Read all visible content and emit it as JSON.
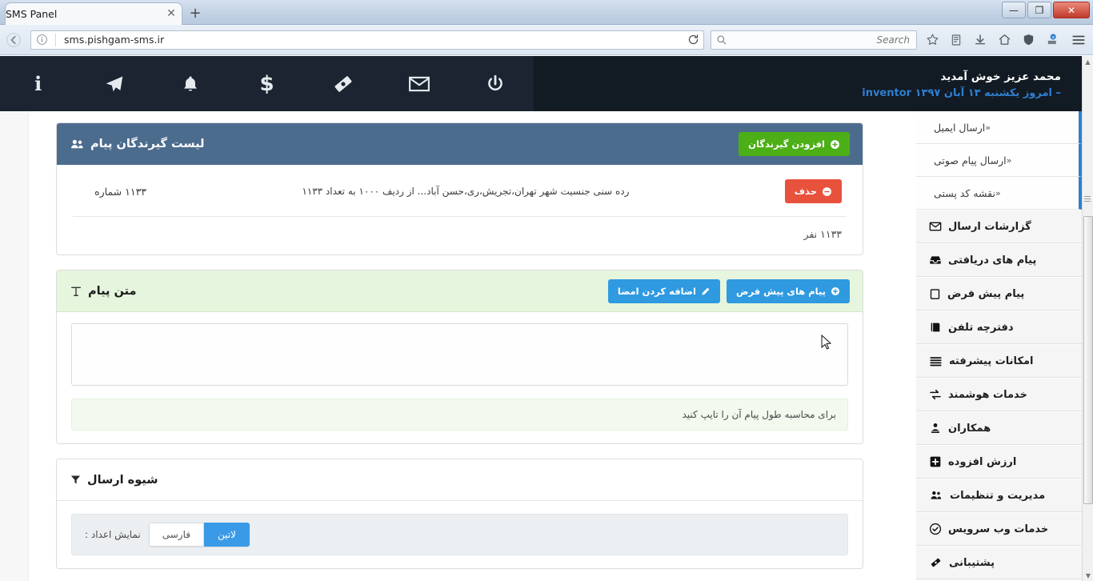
{
  "browser": {
    "tab_title": "SMS Panel",
    "tab_close_glyph": "✕",
    "new_tab_glyph": "+",
    "url": "sms.pishgam-sms.ir",
    "search_placeholder": "Search",
    "window_minimize": "—",
    "window_restore": "❐",
    "window_close": "✕"
  },
  "appbar": {
    "icons": [
      {
        "name": "power-icon"
      },
      {
        "name": "envelope-icon"
      },
      {
        "name": "ticket-icon"
      },
      {
        "name": "dollar-icon"
      },
      {
        "name": "bell-icon"
      },
      {
        "name": "paper-plane-icon"
      },
      {
        "name": "info-icon"
      }
    ],
    "welcome_line1": "محمد عزیز خوش آمدید",
    "welcome_user": "inventor",
    "welcome_line2": "– امروز یکشنبه ۱۳ آبان ۱۳۹۷"
  },
  "sidebar": {
    "sub_items": [
      {
        "label": "ارسال ایمیل",
        "chevron": "«"
      },
      {
        "label": "ارسال پیام صوتی",
        "chevron": "«"
      },
      {
        "label": "نقشه کد پستی",
        "chevron": "«"
      }
    ],
    "main_items": [
      {
        "label": "گزارشات ارسال",
        "icon": "envelope-icon"
      },
      {
        "label": "پیام های دریافتی",
        "icon": "inbox-icon"
      },
      {
        "label": "پیام پیش فرض",
        "icon": "note-icon"
      },
      {
        "label": "دفترچه تلفن",
        "icon": "book-icon"
      },
      {
        "label": "امکانات پیشرفته",
        "icon": "bars-icon"
      },
      {
        "label": "خدمات هوشمند",
        "icon": "exchange-icon"
      },
      {
        "label": "همکاران",
        "icon": "user-tie-icon"
      },
      {
        "label": "ارزش افزوده",
        "icon": "plus-square-icon"
      },
      {
        "label": "مدیریت و تنظیمات",
        "icon": "users-icon"
      },
      {
        "label": "خدمات وب سرویس",
        "icon": "check-circle-icon"
      },
      {
        "label": "پشتیبانی",
        "icon": "ticket-icon"
      }
    ]
  },
  "recipients_panel": {
    "title": "لیست گیرندگان پیام",
    "title_icon": "users-icon",
    "add_button": "افزودن گیرندگان",
    "add_button_icon": "plus-circle-icon",
    "row": {
      "number": "۱۱۳۳ شماره",
      "description": "رده سنی جنسیت شهر تهران،تجریش،ری،حسن آباد...    از ردیف ۱۰۰۰ به تعداد ۱۱۳۳",
      "delete_button": "حذف",
      "delete_icon": "minus-circle-icon"
    },
    "footer_count": "۱۱۳۳ نفر"
  },
  "message_panel": {
    "title": "متن پیام",
    "title_icon": "text-icon",
    "default_messages_button": "پیام های پیش فرض",
    "default_messages_icon": "plus-circle-icon",
    "signature_button": "اضافه کردن امضا",
    "signature_icon": "pencil-icon",
    "textarea_value": "",
    "textarea_placeholder": "",
    "hint": "برای محاسبه طول پیام آن را تایپ کنید"
  },
  "send_panel": {
    "title": "شیوه ارسال",
    "title_icon": "filter-icon",
    "numbers_label": "نمایش اعداد :",
    "toggle_options": [
      {
        "label": "فارسی",
        "active": false
      },
      {
        "label": "لاتین",
        "active": true
      }
    ]
  },
  "colors": {
    "appbar_bg": "#121a24",
    "appbar_icons_bg": "#1b2430",
    "panel_header_blue": "#4c6c8e",
    "panel_header_green": "#e6f5dd",
    "accent_blue": "#2f7fd0",
    "button_green": "#4caf17",
    "button_blue": "#2f9ae0",
    "button_red": "#e8513c"
  }
}
